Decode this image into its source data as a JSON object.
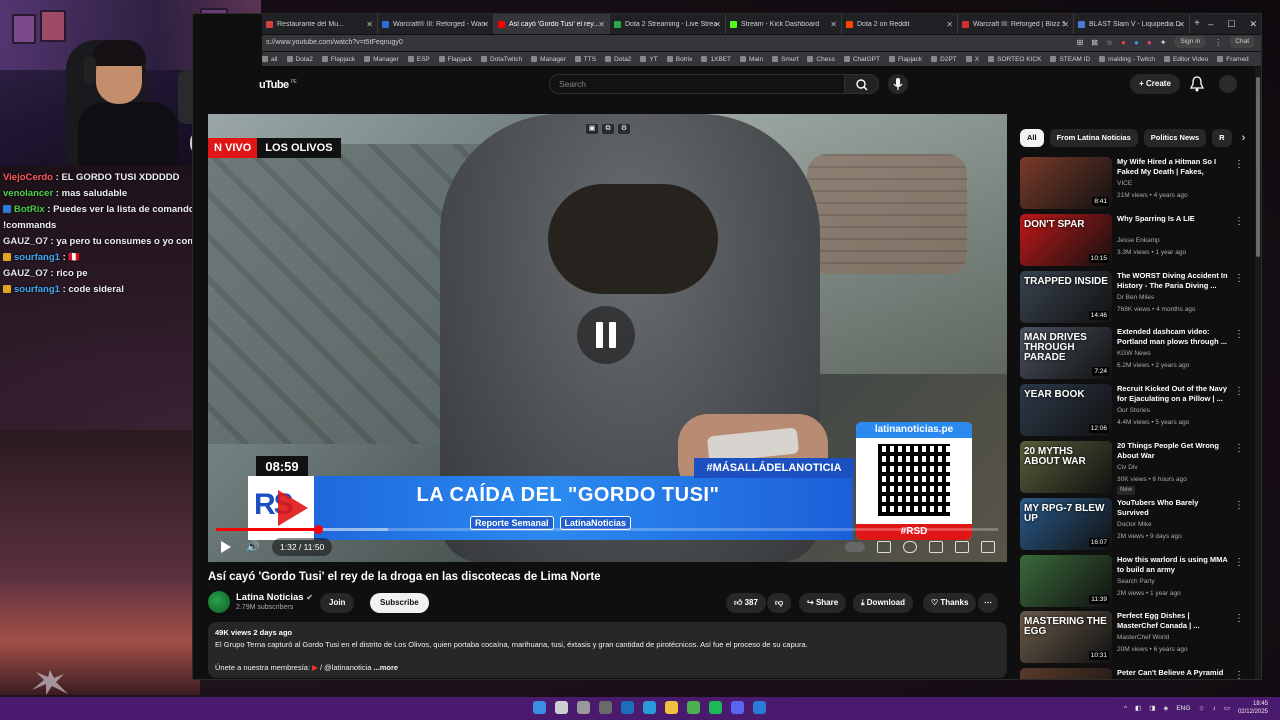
{
  "chat": [
    {
      "user": "ViejoCerdo",
      "color": "#ff5a5a",
      "message": "EL GORDO TUSI XDDDDD",
      "badge": ""
    },
    {
      "user": "venolancer",
      "color": "#4fd24f",
      "message": "mas saludable",
      "badge": ""
    },
    {
      "user": "BotRix",
      "color": "#43d143",
      "message": "Puedes ver la lista de comandos con !commands",
      "badge": "#2c7bd6"
    },
    {
      "user": "GAUZ_O7",
      "color": "#e9e9e9",
      "message": "ya pero tu consumes o yo consumo?",
      "badge": ""
    },
    {
      "user": "sourfang1",
      "color": "#3fa9f5",
      "message": "🇵🇪",
      "badge": "#e0a423"
    },
    {
      "user": "GAUZ_O7",
      "color": "#e9e9e9",
      "message": "rico pe",
      "badge": ""
    },
    {
      "user": "sourfang1",
      "color": "#3fa9f5",
      "message": "code sideral",
      "badge": "#e0a423"
    }
  ],
  "browser": {
    "tabs": [
      {
        "title": "Restaurante del Mu...",
        "color": "#d04040",
        "active": false
      },
      {
        "title": "Warcraft® III: Reforged - Warcra...",
        "color": "#2c6bd8",
        "active": false
      },
      {
        "title": "Así cayó 'Gordo Tusi' el rey...",
        "color": "#ff0000",
        "active": true
      },
      {
        "title": "Dota 2 Streaming - Live Stream...",
        "color": "#2ba84a",
        "active": false
      },
      {
        "title": "Stream - Kick Dashboard",
        "color": "#53fc18",
        "active": false
      },
      {
        "title": "Dota 2 on Reddit",
        "color": "#ff4500",
        "active": false
      },
      {
        "title": "Warcraft III: Reforged | Blizz Stor...",
        "color": "#d03030",
        "active": false
      },
      {
        "title": "BLAST Slam V - Liquipedia Dota...",
        "color": "#4a7bd6",
        "active": false
      }
    ],
    "url": "s://www.youtube.com/watch?v=t5tFeqnugy0",
    "sign_in": "Sign in",
    "chat_label": "Chat",
    "bookmarks": [
      "ail",
      "Dota2",
      "Flapjack",
      "Manager",
      "ESP",
      "Flapjack",
      "DotaTwitch",
      "Manager",
      "TTS",
      "Dota2",
      "YT",
      "Botrix",
      "1XBET",
      "Main",
      "Smurf",
      "Chess",
      "ChatGPT",
      "Flapjack",
      "D2PT",
      "X",
      "SORTEO KICK",
      "STEAM ID",
      "malding - Twitch",
      "Editor Video",
      "Framed"
    ]
  },
  "youtube": {
    "logo": "uTube",
    "logo_region": "PE",
    "search_placeholder": "Search",
    "create_label": "Create",
    "video": {
      "live_tag": "N VIVO",
      "place_tag": "LOS OLIVOS",
      "overlay_time": "08:59",
      "banner_title": "LA CAÍDA DEL \"GORDO TUSI\"",
      "banner_sub1": "Reporte Semanal",
      "banner_sub2": "LatinaNoticias",
      "hashtag": "#MÁSALLÁDELANOTICIA",
      "qr_head": "latinanoticias.pe",
      "qr_foot": "#RSD",
      "time": "1:32 / 11:50",
      "progress_played": 0.13,
      "progress_buffered": 0.22
    },
    "title": "Así cayó 'Gordo Tusi' el rey de la droga en las discotecas de Lima Norte",
    "channel": {
      "name": "Latina Noticias",
      "subs": "2.79M subscribers",
      "join": "Join",
      "subscribe": "Subscribe"
    },
    "actions": {
      "likes": "387",
      "share": "Share",
      "download": "Download",
      "thanks": "Thanks"
    },
    "description": {
      "meta": "49K views  2 days ago",
      "text": "El Grupo Terna capturó al Gordo Tusi en el distrito de Los Olivos, quien portaba cocaína, marihuana, tusi, éxtasis y gran cantidad de pirotécnicos. Así fue el proceso de su capura.",
      "more_prefix": "Únete a nuestra membresía:",
      "more_handle": "/ @latinanoticia",
      "more": "...more"
    },
    "chips": [
      "All",
      "From Latina Noticias",
      "Politics News",
      "R"
    ],
    "recommendations": [
      {
        "title": "My Wife Hired a Hitman So I Faked My Death | Fakes, Fraud...",
        "channel": "VICE",
        "meta": "21M views • 4 years ago",
        "duration": "8:41",
        "thumb_text": "",
        "thumb_color": "#7a3b2a",
        "badge": ""
      },
      {
        "title": "Why Sparring Is A LIE",
        "channel": "Jesse Enkamp",
        "meta": "3.3M views • 1 year ago",
        "duration": "10:15",
        "thumb_text": "DON'T SPAR",
        "thumb_color": "#c01818",
        "badge": ""
      },
      {
        "title": "The WORST Diving Accident In History - The Paria Diving ...",
        "channel": "Dr Ben Miles",
        "meta": "768K views • 4 months ago",
        "duration": "14:46",
        "thumb_text": "TRAPPED INSIDE",
        "thumb_color": "#3a4450",
        "badge": ""
      },
      {
        "title": "Extended dashcam video: Portland man plows through ...",
        "channel": "KGW News",
        "meta": "6.2M views • 2 years ago",
        "duration": "7:24",
        "thumb_text": "MAN DRIVES THROUGH PARADE",
        "thumb_color": "#4a5360",
        "badge": ""
      },
      {
        "title": "Recruit Kicked Out of the Navy for Ejaculating on a Pillow | ...",
        "channel": "Our Stories",
        "meta": "4.4M views • 5 years ago",
        "duration": "12:06",
        "thumb_text": "YEAR BOOK",
        "thumb_color": "#2d3a4a",
        "badge": ""
      },
      {
        "title": "20 Things People Get Wrong About War",
        "channel": "Civ Div",
        "meta": "30K views • 6 hours ago",
        "duration": "",
        "thumb_text": "20 MYTHS ABOUT WAR",
        "thumb_color": "#5a5e3a",
        "badge": "New"
      },
      {
        "title": "YouTubers Who Barely Survived",
        "channel": "Doctor Mike",
        "meta": "2M views • 9 days ago",
        "duration": "16:07",
        "thumb_text": "MY RPG-7 BLEW UP",
        "thumb_color": "#2a5a8a",
        "badge": ""
      },
      {
        "title": "How this warlord is using MMA to build an army",
        "channel": "Search Party",
        "meta": "2M views • 1 year ago",
        "duration": "11:39",
        "thumb_text": "",
        "thumb_color": "#3a6a3a",
        "badge": ""
      },
      {
        "title": "Perfect Egg Dishes | MasterChef Canada | ...",
        "channel": "MasterChef World",
        "meta": "20M views • 6 years ago",
        "duration": "10:31",
        "thumb_text": "MASTERING THE EGG",
        "thumb_color": "#6a5a4a",
        "badge": ""
      },
      {
        "title": "Peter Can't Believe A Pyramid Scheme Business Model's ...",
        "channel": "",
        "meta": "",
        "duration": "",
        "thumb_text": "",
        "thumb_color": "#5a3a2a",
        "badge": ""
      }
    ]
  },
  "taskbar": {
    "lang": "ENG",
    "time": "18:45",
    "date": "02/12/2025",
    "icon_colors": [
      "#3a8ee6",
      "#cfcfcf",
      "#9a9a9a",
      "#6a6a6a",
      "#1b6fb8",
      "#2a9ad8",
      "#f0c040",
      "#4caf50",
      "#1db954",
      "#5865f2",
      "#2a7ad8"
    ]
  }
}
